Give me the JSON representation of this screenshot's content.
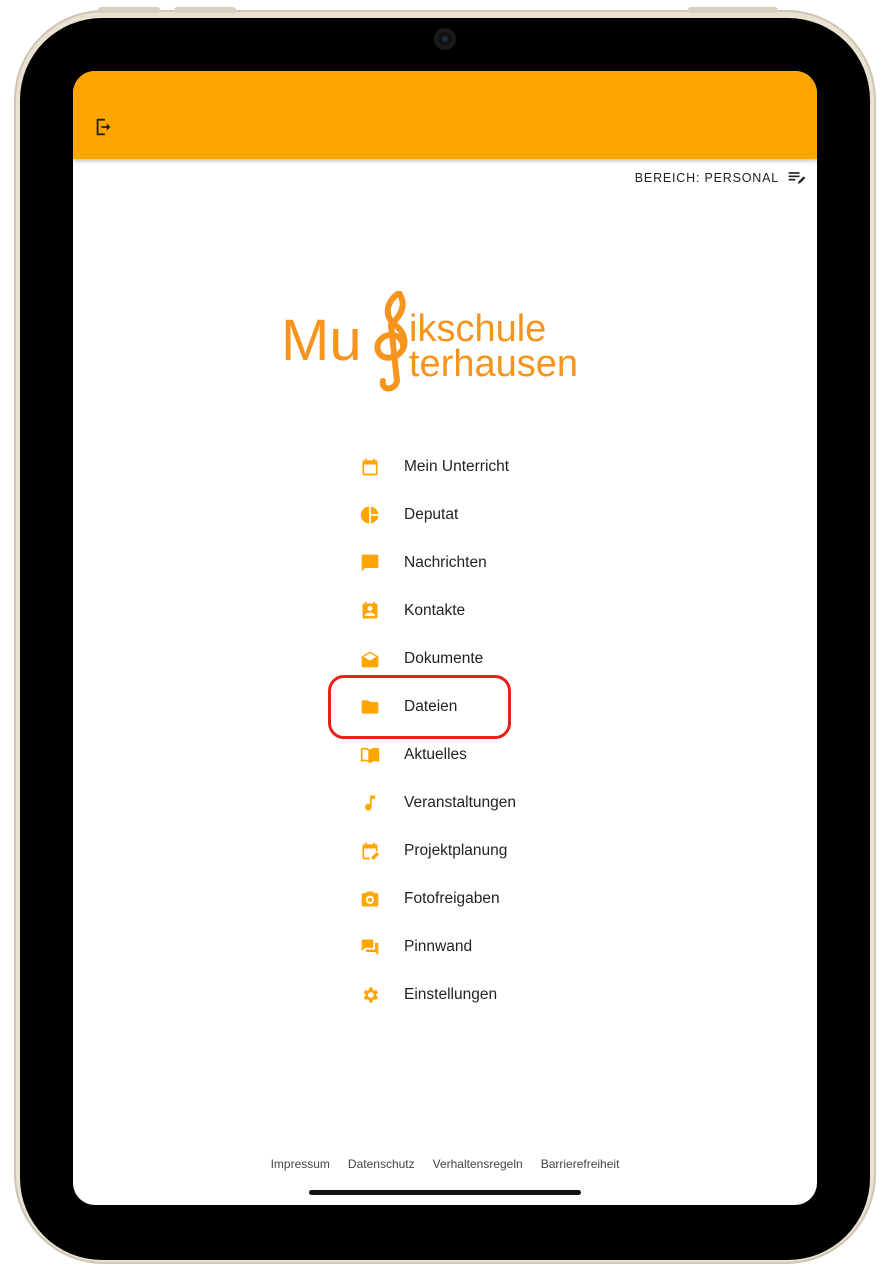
{
  "colors": {
    "accent": "#ffa500",
    "highlight": "#e8201a"
  },
  "header": {
    "logout_icon": "logout-icon"
  },
  "area": {
    "label": "BEREICH: PERSONAL",
    "icon": "edit-list-icon"
  },
  "logo": {
    "line1_a": "Mu",
    "line1_b": "ikschule",
    "line2": "terhausen"
  },
  "menu": [
    {
      "label": "Mein Unterricht",
      "icon": "calendar-icon"
    },
    {
      "label": "Deputat",
      "icon": "pie-chart-icon"
    },
    {
      "label": "Nachrichten",
      "icon": "chat-icon"
    },
    {
      "label": "Kontakte",
      "icon": "contact-icon"
    },
    {
      "label": "Dokumente",
      "icon": "open-envelope-icon"
    },
    {
      "label": "Dateien",
      "icon": "folder-icon"
    },
    {
      "label": "Aktuelles",
      "icon": "book-icon"
    },
    {
      "label": "Veranstaltungen",
      "icon": "music-note-icon"
    },
    {
      "label": "Projektplanung",
      "icon": "calendar-edit-icon"
    },
    {
      "label": "Fotofreigaben",
      "icon": "camera-icon"
    },
    {
      "label": "Pinnwand",
      "icon": "forum-icon"
    },
    {
      "label": "Einstellungen",
      "icon": "gear-icon"
    }
  ],
  "footer": {
    "links": [
      "Impressum",
      "Datenschutz",
      "Verhaltensregeln",
      "Barrierefreiheit"
    ]
  }
}
